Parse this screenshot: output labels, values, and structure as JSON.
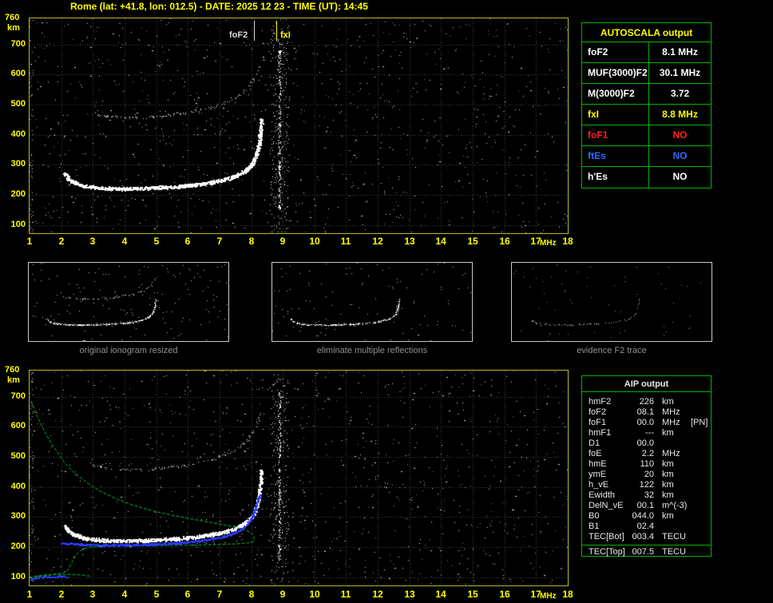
{
  "title": "Rome (lat: +41.8, lon: 012.5) - DATE: 2025 12 23 - TIME (UT): 14:45",
  "colors": {
    "background": "#000000",
    "accent_yellow": "#ffff00",
    "plot_border_yellow": "#b9b62a",
    "table_border_green": "#00b400",
    "trace_white": "#ffffff",
    "profile_green": "#00c332",
    "fitted_blue": "#2a3bff",
    "no_red": "#ff2020",
    "es_blue": "#2e6bff",
    "caption_gray": "#8f8f8f"
  },
  "markers": {
    "fof2_label": "foF2",
    "fxi_label": "fxI",
    "fof2_mhz": 8.1,
    "fxi_mhz": 8.8
  },
  "axes": {
    "y_top_label": "760",
    "y_unit": "km",
    "y_ticks": [
      700,
      600,
      500,
      400,
      300,
      200,
      100
    ],
    "x_ticks": [
      1,
      2,
      3,
      4,
      5,
      6,
      7,
      8,
      9,
      10,
      11,
      12,
      13,
      14,
      15,
      16,
      17,
      18
    ],
    "x_unit": "MHz"
  },
  "autoscala": {
    "title": "AUTOSCALA output",
    "rows": [
      {
        "label": "foF2",
        "value": "8.1 MHz",
        "color": "#ffffff"
      },
      {
        "label": "MUF(3000)F2",
        "value": "30.1 MHz",
        "color": "#ffffff"
      },
      {
        "label": "M(3000)F2",
        "value": "3.72",
        "color": "#ffffff"
      },
      {
        "label": "fxI",
        "value": "8.8 MHz",
        "color": "#ffff00"
      },
      {
        "label": "foF1",
        "value": "NO",
        "color": "#ff2020"
      },
      {
        "label": "ftEs",
        "value": "NO",
        "color": "#2e6bff"
      },
      {
        "label": "h'Es",
        "value": "NO",
        "color": "#ffffff"
      }
    ]
  },
  "aip": {
    "title": "AIP output",
    "rows": [
      {
        "label": "hmF2",
        "value": "226",
        "unit": "km",
        "extra": ""
      },
      {
        "label": "foF2",
        "value": "08.1",
        "unit": "MHz",
        "extra": ""
      },
      {
        "label": "foF1",
        "value": "00.0",
        "unit": "MHz",
        "extra": "[PN]"
      },
      {
        "label": "hmF1",
        "value": "---",
        "unit": "km",
        "extra": ""
      },
      {
        "label": "D1",
        "value": "00.0",
        "unit": "",
        "extra": ""
      },
      {
        "label": "foE",
        "value": "2.2",
        "unit": "MHz",
        "extra": ""
      },
      {
        "label": "hmE",
        "value": "110",
        "unit": "km",
        "extra": ""
      },
      {
        "label": "ymE",
        "value": "20",
        "unit": "km",
        "extra": ""
      },
      {
        "label": "h_vE",
        "value": "122",
        "unit": "km",
        "extra": ""
      },
      {
        "label": "Ewidth",
        "value": "32",
        "unit": "km",
        "extra": ""
      },
      {
        "label": "DelN_vE",
        "value": "00.1",
        "unit": "m^(-3)",
        "extra": ""
      },
      {
        "label": "B0",
        "value": "044.0",
        "unit": "km",
        "extra": ""
      },
      {
        "label": "B1",
        "value": "02.4",
        "unit": "",
        "extra": ""
      },
      {
        "label": "TEC[Bot]",
        "value": "003.4",
        "unit": "TECU",
        "extra": ""
      },
      {
        "label": "TEC[Top]",
        "value": "007.5",
        "unit": "TECU",
        "extra": ""
      }
    ]
  },
  "thumbnails": [
    {
      "caption": "original ionogram resized"
    },
    {
      "caption": "eliminate multiple reflections"
    },
    {
      "caption": "evidence F2 trace"
    }
  ],
  "chart_data": {
    "type": "scatter",
    "title": "Rome ionogram 2025-12-23 14:45 UT",
    "xlabel": "MHz",
    "ylabel": "km",
    "xlim": [
      1,
      18
    ],
    "ylim": [
      100,
      760
    ],
    "markers": {
      "foF2_MHz": 8.1,
      "fxI_MHz": 8.8
    },
    "traces": {
      "f2_ordinary": [
        [
          2.1,
          272
        ],
        [
          2.25,
          252
        ],
        [
          2.45,
          240
        ],
        [
          2.7,
          231
        ],
        [
          3.0,
          226
        ],
        [
          3.5,
          222
        ],
        [
          4.0,
          221
        ],
        [
          4.5,
          222
        ],
        [
          5.0,
          224
        ],
        [
          5.5,
          227
        ],
        [
          6.0,
          231
        ],
        [
          6.4,
          236
        ],
        [
          6.8,
          243
        ],
        [
          7.2,
          252
        ],
        [
          7.5,
          263
        ],
        [
          7.8,
          279
        ],
        [
          8.0,
          297
        ],
        [
          8.1,
          315
        ],
        [
          8.18,
          338
        ],
        [
          8.24,
          363
        ],
        [
          8.28,
          394
        ],
        [
          8.31,
          428
        ],
        [
          8.33,
          452
        ]
      ],
      "f2_multiple": [
        [
          3.0,
          470
        ],
        [
          3.4,
          462
        ],
        [
          3.9,
          457
        ],
        [
          4.4,
          456
        ],
        [
          4.9,
          459
        ],
        [
          5.4,
          464
        ],
        [
          5.9,
          471
        ],
        [
          6.4,
          481
        ],
        [
          6.9,
          495
        ],
        [
          7.3,
          511
        ],
        [
          7.6,
          529
        ],
        [
          7.85,
          551
        ],
        [
          8.05,
          579
        ],
        [
          8.2,
          611
        ],
        [
          8.3,
          642
        ]
      ],
      "x_mode_band": {
        "f_center": 8.9,
        "f_spread": 0.6,
        "h_min": 150,
        "h_max": 720
      },
      "profile_green": [
        [
          1.05,
          685
        ],
        [
          1.2,
          645
        ],
        [
          1.4,
          600
        ],
        [
          1.6,
          560
        ],
        [
          1.85,
          520
        ],
        [
          2.1,
          482
        ],
        [
          2.4,
          448
        ],
        [
          2.8,
          415
        ],
        [
          3.2,
          388
        ],
        [
          3.7,
          362
        ],
        [
          4.2,
          342
        ],
        [
          4.7,
          326
        ],
        [
          5.2,
          313
        ],
        [
          5.7,
          302
        ],
        [
          6.2,
          292
        ],
        [
          6.7,
          283
        ],
        [
          7.1,
          275
        ],
        [
          7.5,
          267
        ],
        [
          7.8,
          258
        ],
        [
          8.0,
          248
        ],
        [
          8.08,
          238
        ],
        [
          8.1,
          226
        ],
        [
          8.07,
          218
        ],
        [
          7.9,
          214
        ],
        [
          7.5,
          211
        ],
        [
          7.0,
          209
        ],
        [
          6.3,
          207
        ],
        [
          5.5,
          206
        ],
        [
          4.7,
          205
        ],
        [
          4.0,
          204
        ],
        [
          3.4,
          203
        ],
        [
          3.0,
          201
        ],
        [
          2.75,
          196
        ],
        [
          2.6,
          188
        ],
        [
          2.5,
          178
        ],
        [
          2.42,
          166
        ],
        [
          2.36,
          154
        ],
        [
          2.3,
          142
        ],
        [
          2.26,
          132
        ],
        [
          2.2,
          122
        ],
        [
          2.1,
          116
        ],
        [
          1.9,
          111
        ],
        [
          1.6,
          107
        ],
        [
          1.35,
          103
        ],
        [
          1.15,
          99
        ],
        [
          1.05,
          96
        ]
      ],
      "profile_e_green": [
        [
          1.0,
          100
        ],
        [
          1.2,
          104
        ],
        [
          1.5,
          108
        ],
        [
          1.8,
          110
        ],
        [
          2.0,
          107
        ],
        [
          2.2,
          110
        ],
        [
          2.6,
          108
        ],
        [
          2.9,
          104
        ]
      ],
      "fitted_blue": [
        [
          2.0,
          214
        ],
        [
          2.4,
          211
        ],
        [
          2.9,
          208
        ],
        [
          3.5,
          207
        ],
        [
          4.2,
          208
        ],
        [
          4.9,
          210
        ],
        [
          5.5,
          213
        ],
        [
          6.0,
          217
        ],
        [
          6.5,
          223
        ],
        [
          7.0,
          232
        ],
        [
          7.4,
          244
        ],
        [
          7.7,
          259
        ],
        [
          7.9,
          279
        ],
        [
          8.05,
          303
        ],
        [
          8.15,
          329
        ],
        [
          8.22,
          354
        ],
        [
          8.27,
          372
        ]
      ],
      "fitted_blue_e": [
        [
          1.0,
          95
        ],
        [
          1.25,
          99
        ],
        [
          1.5,
          103
        ],
        [
          1.75,
          100
        ],
        [
          1.95,
          104
        ],
        [
          2.15,
          102
        ]
      ]
    }
  }
}
